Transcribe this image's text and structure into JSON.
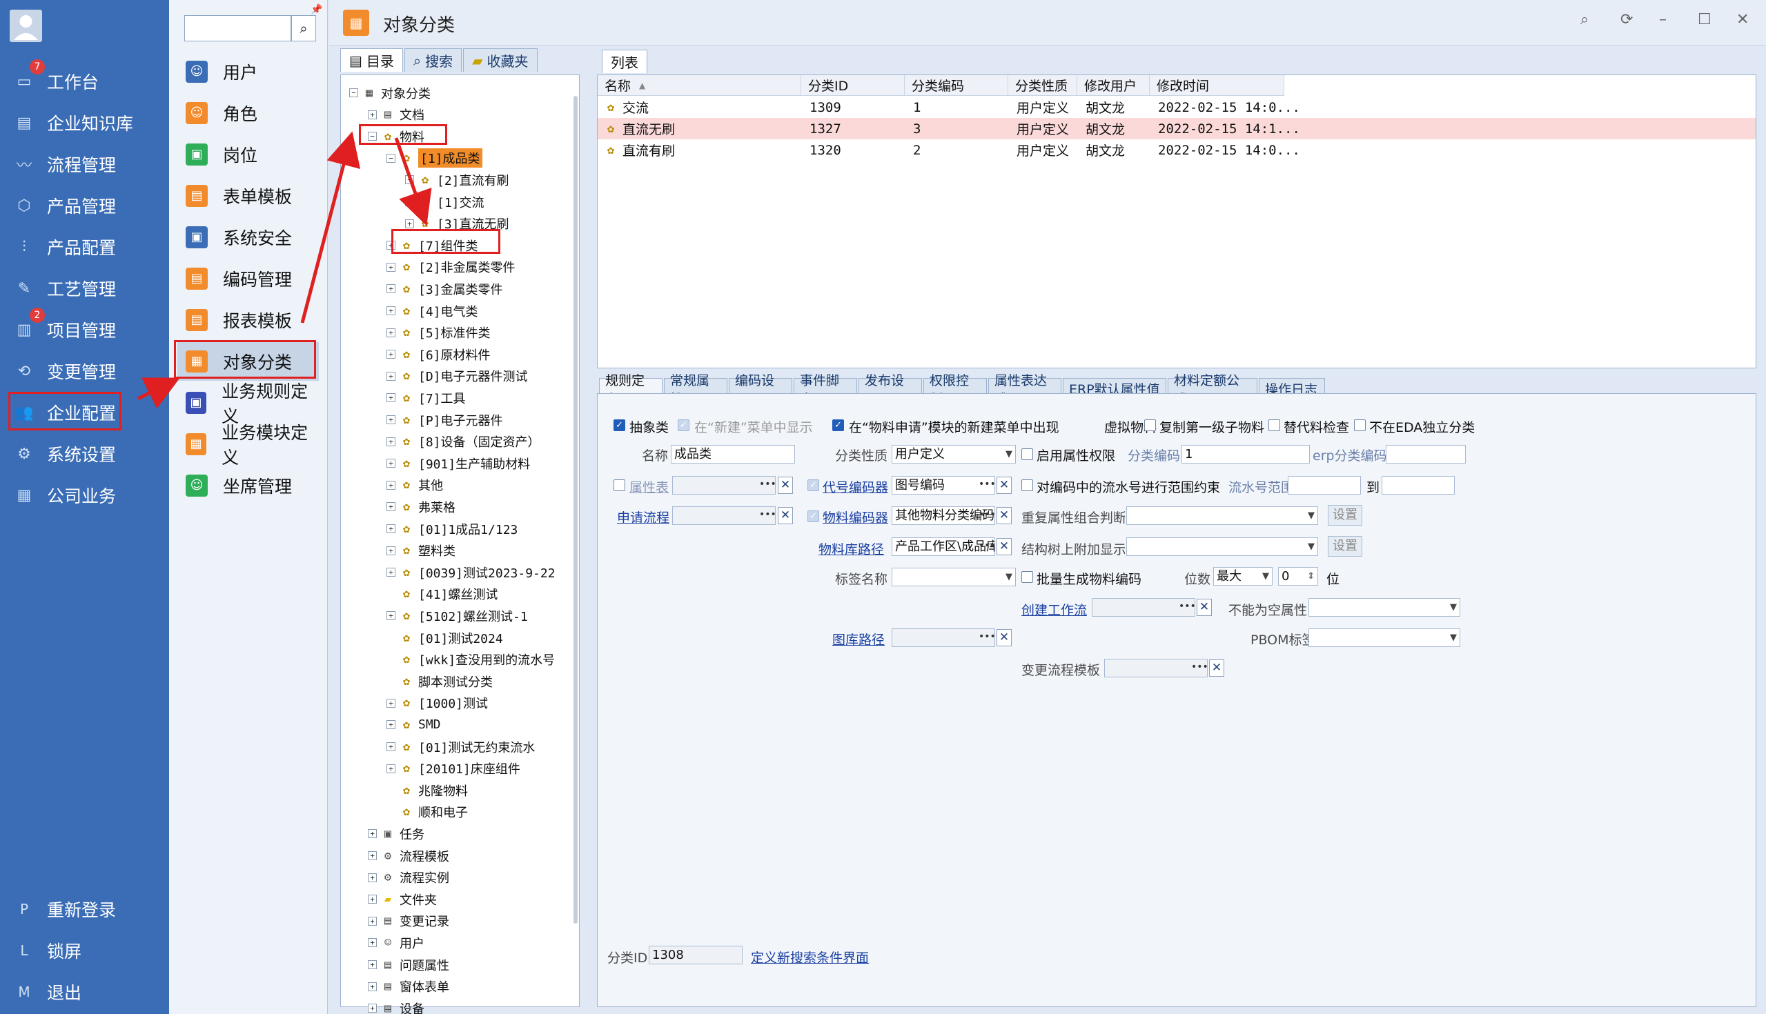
{
  "nav": {
    "items": [
      {
        "label": "工作台",
        "icon": "monitor-icon",
        "glyph": "▭",
        "badge": "7"
      },
      {
        "label": "企业知识库",
        "icon": "book-icon",
        "glyph": "▤"
      },
      {
        "label": "流程管理",
        "icon": "flow-icon",
        "glyph": "〰"
      },
      {
        "label": "产品管理",
        "icon": "cube-icon",
        "glyph": "⬡"
      },
      {
        "label": "产品配置",
        "icon": "sliders-icon",
        "glyph": "⫶"
      },
      {
        "label": "工艺管理",
        "icon": "wrench-icon",
        "glyph": "✎"
      },
      {
        "label": "项目管理",
        "icon": "chart-icon",
        "glyph": "▥",
        "badge": "2"
      },
      {
        "label": "变更管理",
        "icon": "change-icon",
        "glyph": "⟲"
      },
      {
        "label": "企业配置",
        "icon": "users-icon",
        "glyph": "👥"
      },
      {
        "label": "系统设置",
        "icon": "gear-icon",
        "glyph": "⚙"
      },
      {
        "label": "公司业务",
        "icon": "grid-icon",
        "glyph": "▦"
      }
    ],
    "bottom": [
      {
        "label": "重新登录",
        "glyph": "P"
      },
      {
        "label": "锁屏",
        "glyph": "L"
      },
      {
        "label": "退出",
        "glyph": "M"
      }
    ]
  },
  "col2": {
    "search_placeholder": "",
    "items": [
      {
        "label": "用户",
        "color": "#3a6db5",
        "glyph": "☺"
      },
      {
        "label": "角色",
        "color": "#f28b2b",
        "glyph": "☺"
      },
      {
        "label": "岗位",
        "color": "#2fae5a",
        "glyph": "▣"
      },
      {
        "label": "表单模板",
        "color": "#f28b2b",
        "glyph": "▤"
      },
      {
        "label": "系统安全",
        "color": "#3a6db5",
        "glyph": "▣"
      },
      {
        "label": "编码管理",
        "color": "#f28b2b",
        "glyph": "▤"
      },
      {
        "label": "报表模板",
        "color": "#f28b2b",
        "glyph": "▤"
      },
      {
        "label": "对象分类",
        "color": "#f28b2b",
        "glyph": "▦"
      },
      {
        "label": "业务规则定义",
        "color": "#3a4fb5",
        "glyph": "▣"
      },
      {
        "label": "业务模块定义",
        "color": "#f28b2b",
        "glyph": "▦"
      },
      {
        "label": "坐席管理",
        "color": "#2fae5a",
        "glyph": "☺"
      }
    ]
  },
  "window": {
    "title": "对象分类"
  },
  "lefttabs": [
    "目录",
    "搜索",
    "收藏夹"
  ],
  "tree": [
    {
      "t": "对象分类",
      "lvl": 0,
      "pm": "−",
      "ic": "▦"
    },
    {
      "t": "文档",
      "lvl": 1,
      "pm": "+",
      "ic": "▤"
    },
    {
      "t": "物料",
      "lvl": 1,
      "pm": "−",
      "ic": "bee"
    },
    {
      "t": "[1]成品类",
      "lvl": 2,
      "pm": "−",
      "ic": "bee",
      "hl": true
    },
    {
      "t": "[2]直流有刷",
      "lvl": 3,
      "pm": "+",
      "ic": "bee"
    },
    {
      "t": "[1]交流",
      "lvl": 3,
      "pm": "+",
      "ic": "bee"
    },
    {
      "t": "[3]直流无刷",
      "lvl": 3,
      "pm": "+",
      "ic": "bee"
    },
    {
      "t": "[7]组件类",
      "lvl": 2,
      "pm": "+",
      "ic": "bee"
    },
    {
      "t": "[2]非金属类零件",
      "lvl": 2,
      "pm": "+",
      "ic": "bee"
    },
    {
      "t": "[3]金属类零件",
      "lvl": 2,
      "pm": "+",
      "ic": "bee"
    },
    {
      "t": "[4]电气类",
      "lvl": 2,
      "pm": "+",
      "ic": "bee"
    },
    {
      "t": "[5]标准件类",
      "lvl": 2,
      "pm": "+",
      "ic": "bee"
    },
    {
      "t": "[6]原材料件",
      "lvl": 2,
      "pm": "+",
      "ic": "bee"
    },
    {
      "t": "[D]电子元器件测试",
      "lvl": 2,
      "pm": "+",
      "ic": "bee"
    },
    {
      "t": "[7]工具",
      "lvl": 2,
      "pm": "+",
      "ic": "bee"
    },
    {
      "t": "[P]电子元器件",
      "lvl": 2,
      "pm": "+",
      "ic": "bee"
    },
    {
      "t": "[8]设备（固定资产）",
      "lvl": 2,
      "pm": "+",
      "ic": "bee"
    },
    {
      "t": "[901]生产辅助材料",
      "lvl": 2,
      "pm": "+",
      "ic": "bee"
    },
    {
      "t": "其他",
      "lvl": 2,
      "pm": "+",
      "ic": "bee"
    },
    {
      "t": "弗莱格",
      "lvl": 2,
      "pm": "+",
      "ic": "bee"
    },
    {
      "t": "[01]1成品1/123",
      "lvl": 2,
      "pm": "+",
      "ic": "bee"
    },
    {
      "t": "塑料类",
      "lvl": 2,
      "pm": "+",
      "ic": "bee"
    },
    {
      "t": "[0039]测试2023-9-22",
      "lvl": 2,
      "pm": "+",
      "ic": "bee"
    },
    {
      "t": "[41]螺丝测试",
      "lvl": 2,
      "pm": "",
      "ic": "bee"
    },
    {
      "t": "[5102]螺丝测试-1",
      "lvl": 2,
      "pm": "+",
      "ic": "bee"
    },
    {
      "t": "[01]测试2024",
      "lvl": 2,
      "pm": "",
      "ic": "bee"
    },
    {
      "t": "[wkk]查没用到的流水号",
      "lvl": 2,
      "pm": "",
      "ic": "bee"
    },
    {
      "t": "脚本测试分类",
      "lvl": 2,
      "pm": "",
      "ic": "bee"
    },
    {
      "t": "[1000]测试",
      "lvl": 2,
      "pm": "+",
      "ic": "bee"
    },
    {
      "t": "SMD",
      "lvl": 2,
      "pm": "+",
      "ic": "bee"
    },
    {
      "t": "[01]测试无约束流水",
      "lvl": 2,
      "pm": "+",
      "ic": "bee"
    },
    {
      "t": "[20101]床座组件",
      "lvl": 2,
      "pm": "+",
      "ic": "bee"
    },
    {
      "t": "兆隆物料",
      "lvl": 2,
      "pm": "",
      "ic": "bee"
    },
    {
      "t": "顺和电子",
      "lvl": 2,
      "pm": "",
      "ic": "bee"
    },
    {
      "t": "任务",
      "lvl": 1,
      "pm": "+",
      "ic": "▣"
    },
    {
      "t": "流程模板",
      "lvl": 1,
      "pm": "+",
      "ic": "⚙"
    },
    {
      "t": "流程实例",
      "lvl": 1,
      "pm": "+",
      "ic": "⚙"
    },
    {
      "t": "文件夹",
      "lvl": 1,
      "pm": "+",
      "ic": "folder"
    },
    {
      "t": "变更记录",
      "lvl": 1,
      "pm": "+",
      "ic": "▤"
    },
    {
      "t": "用户",
      "lvl": 1,
      "pm": "+",
      "ic": "☺"
    },
    {
      "t": "问题属性",
      "lvl": 1,
      "pm": "+",
      "ic": "▤"
    },
    {
      "t": "窗体表单",
      "lvl": 1,
      "pm": "+",
      "ic": "▤"
    },
    {
      "t": "设备",
      "lvl": 1,
      "pm": "+",
      "ic": "▤"
    }
  ],
  "list": {
    "tab": "列表",
    "headers": [
      "名称",
      "分类ID",
      "分类编码",
      "分类性质",
      "修改用户",
      "修改时间"
    ],
    "rows": [
      [
        "交流",
        "1309",
        "1",
        "用户定义",
        "胡文龙",
        "2022-02-15 14:0..."
      ],
      [
        "直流无刷",
        "1327",
        "3",
        "用户定义",
        "胡文龙",
        "2022-02-15 14:1..."
      ],
      [
        "直流有刷",
        "1320",
        "2",
        "用户定义",
        "胡文龙",
        "2022-02-15 14:0..."
      ]
    ]
  },
  "formtabs": [
    "规则定义",
    "常规属性",
    "编码设置",
    "事件脚本",
    "发布设置",
    "权限控制",
    "属性表达式",
    "ERP默认属性值",
    "材料定额公式",
    "操作日志"
  ],
  "form": {
    "cb_abstract": "抽象类",
    "cb_new_menu": "在“新建”菜单中显示",
    "cb_material_apply": "在“物料申请”模块的新建菜单中出现",
    "cb_virtual": "虚拟物料",
    "cb_copy_first": "复制第一级子物料",
    "cb_substitute": "替代料检查",
    "cb_eda": "不在EDA独立分类",
    "name_label": "名称",
    "name_value": "成品类",
    "nature_label": "分类性质",
    "nature_value": "用户定义",
    "cb_attr_perm": "启用属性权限",
    "code_label": "分类编码",
    "code_value": "1",
    "erp_label": "erp分类编码",
    "attr_table": "属性表",
    "code_gen": "代号编码器",
    "code_gen_value": "图号编码",
    "cb_range": "对编码中的流水号进行范围约束",
    "serial_range": "流水号范围",
    "to": "到",
    "apply_flow": "申请流程",
    "mat_gen": "物料编码器",
    "mat_gen_value": "其他物料分类编码",
    "dup_attr": "重复属性组合判断",
    "set1": "设置",
    "mat_lib": "物料库路径",
    "mat_lib_value": "产品工作区\\成品库",
    "struct_tree": "结构树上附加显示",
    "set2": "设置",
    "tag_name": "标签名称",
    "cb_batch": "批量生成物料编码",
    "digits": "位数",
    "digits_value": "最大",
    "digits_num": "0",
    "wei": "位",
    "create_flow": "创建工作流",
    "not_null": "不能为空属性",
    "drawing_path": "图库路径",
    "pbom": "PBOM标签",
    "change_tpl": "变更流程模板",
    "class_id_label": "分类ID",
    "class_id_value": "1308",
    "define_search": "定义新搜索条件界面"
  }
}
